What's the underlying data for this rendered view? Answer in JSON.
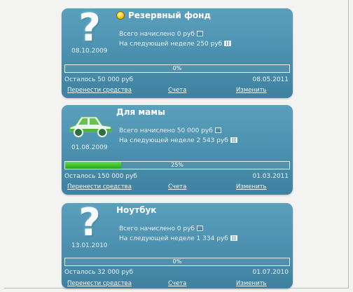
{
  "cards": [
    {
      "icon": "question-icon",
      "title": "Резервный фонд",
      "has_coin": true,
      "start_date": "08.10.2009",
      "accrued": "Всего начислено 0 руб",
      "next_week": "На следующей неделе 250 руб",
      "progress": 0,
      "progress_label": "0%",
      "remaining": "Осталось 50 000 руб",
      "end_date": "08.05.2011",
      "links": {
        "transfer": "Перенести средства",
        "accounts": "Счета",
        "edit": "Изменить"
      }
    },
    {
      "icon": "car-icon",
      "title": "Для мамы",
      "has_coin": false,
      "start_date": "01.08.2009",
      "accrued": "Всего начислено 50 000 руб",
      "next_week": "На следующей неделе 2 543 руб",
      "progress": 0.25,
      "progress_label": "25%",
      "remaining": "Осталось 150 000 руб",
      "end_date": "01.03.2011",
      "links": {
        "transfer": "Перенести средства",
        "accounts": "Счета",
        "edit": "Изменить"
      }
    },
    {
      "icon": "question-icon",
      "title": "Ноутбук",
      "has_coin": false,
      "start_date": "13.01.2010",
      "accrued": "Всего начислено 0 руб",
      "next_week": "На следующей неделе 1 334 руб",
      "progress": 0,
      "progress_label": "0%",
      "remaining": "Осталось 32 000 руб",
      "end_date": "01.07.2010",
      "links": {
        "transfer": "Перенести средства",
        "accounts": "Счета",
        "edit": "Изменить"
      }
    }
  ],
  "colors": {
    "card": "#4d92b0",
    "progress_fill": "#3cc42a",
    "text": "#eaf4f8"
  }
}
